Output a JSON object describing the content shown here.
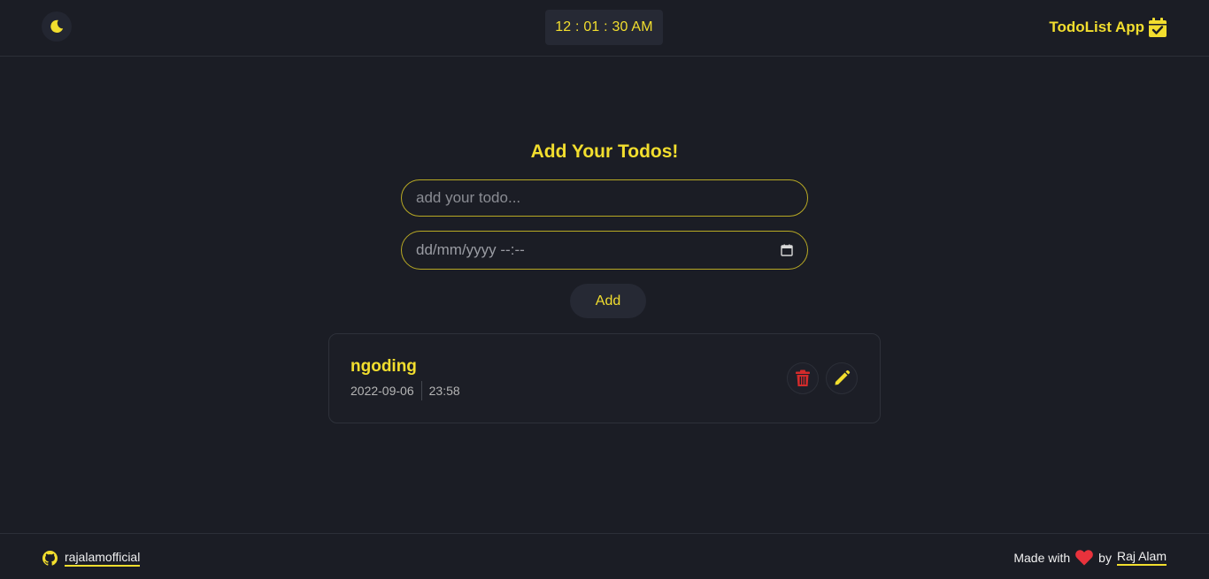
{
  "header": {
    "clock": "12 : 01 : 30 AM",
    "brand": "TodoList App",
    "theme_icon": "moon-icon",
    "brand_icon": "calendar-check-icon"
  },
  "form": {
    "title": "Add Your Todos!",
    "todo_placeholder": "add your todo...",
    "date_placeholder": "dd/mm/yyyy --:--",
    "add_label": "Add"
  },
  "todos": [
    {
      "title": "ngoding",
      "date": "2022-09-06",
      "time": "23:58"
    }
  ],
  "footer": {
    "github_user": "rajalamofficial",
    "made_with": "Made with",
    "by": "by",
    "author": "Raj Alam"
  },
  "colors": {
    "accent": "#f2de2e",
    "background": "#1b1d25",
    "danger": "#d42b2b",
    "heart": "#e8323c"
  }
}
